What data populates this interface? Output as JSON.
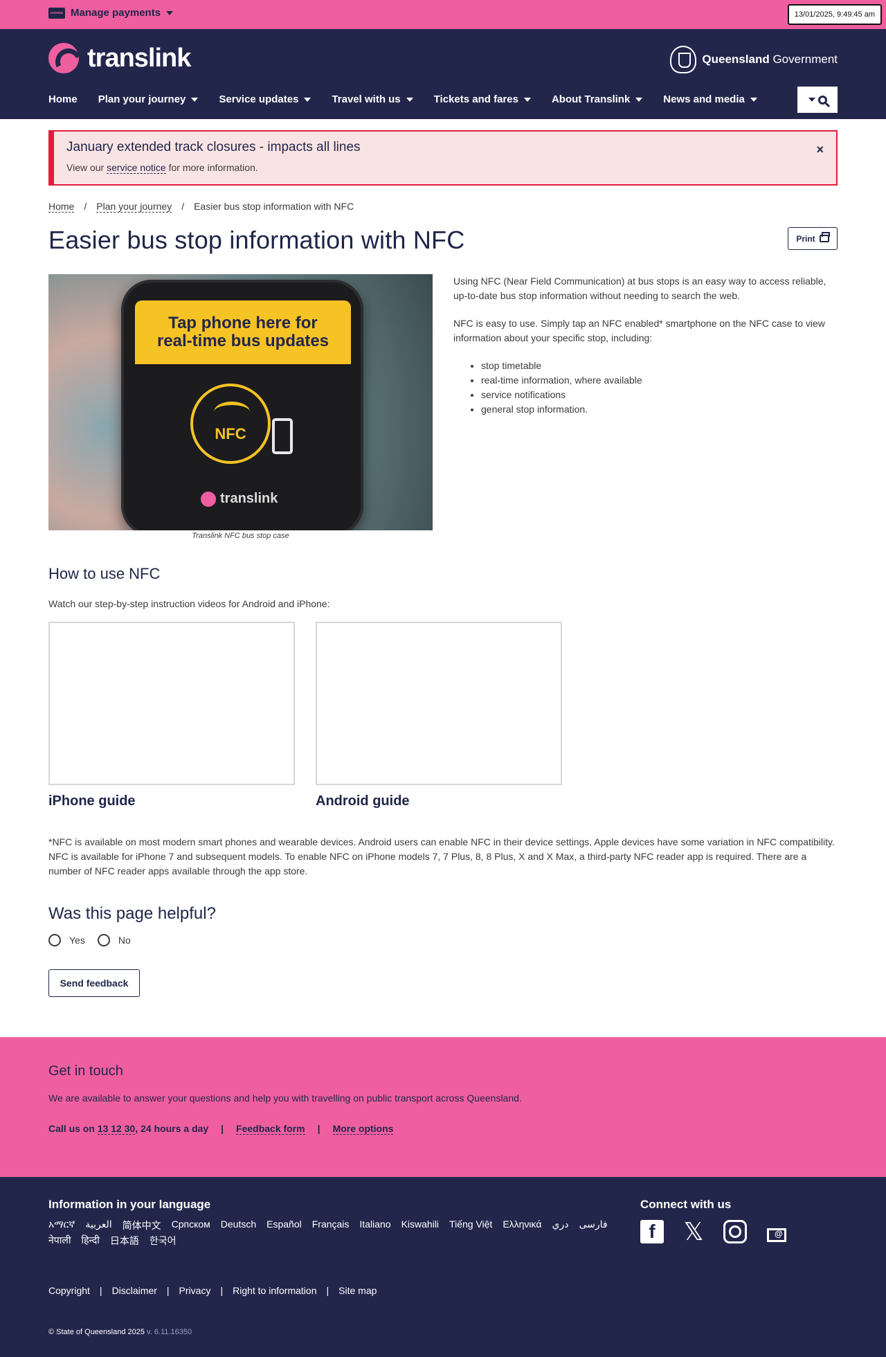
{
  "topbar": {
    "manage_payments": "Manage payments",
    "clock": "13/01/2025, 9:49:45 am"
  },
  "header": {
    "logo_text": "translink",
    "gov_bold": "Queensland",
    "gov_light": "Government",
    "nav": [
      {
        "label": "Home",
        "has_menu": false
      },
      {
        "label": "Plan your journey",
        "has_menu": true
      },
      {
        "label": "Service updates",
        "has_menu": true
      },
      {
        "label": "Travel with us",
        "has_menu": true
      },
      {
        "label": "Tickets and fares",
        "has_menu": true
      },
      {
        "label": "About Translink",
        "has_menu": true
      },
      {
        "label": "News and media",
        "has_menu": true
      }
    ]
  },
  "alert": {
    "title": "January extended track closures - impacts all lines",
    "body_prefix": "View our ",
    "link": "service notice",
    "body_suffix": " for more information.",
    "close": "×"
  },
  "breadcrumb": [
    "Home",
    "Plan your journey",
    "Easier bus stop information with NFC"
  ],
  "page": {
    "title": "Easier bus stop information with NFC",
    "print": "Print"
  },
  "hero": {
    "band_line1": "Tap phone here for",
    "band_line2": "real-time bus updates",
    "nfc": "NFC",
    "brand": "translink",
    "caption": "Translink NFC bus stop case"
  },
  "intro": {
    "p1": "Using NFC (Near Field Communication) at bus stops is an easy way to access reliable, up-to-date bus stop information without needing to search the web.",
    "p2": "NFC is easy to use. Simply tap an NFC enabled* smartphone on the NFC case to view information about your specific stop, including:",
    "items": [
      "stop timetable",
      "real-time information, where available",
      "service notifications",
      "general stop information."
    ]
  },
  "howto": {
    "heading": "How to use NFC",
    "lead": "Watch our step-by-step instruction videos for Android and iPhone:",
    "guides": [
      "iPhone guide",
      "Android guide"
    ]
  },
  "footnote": "*NFC is available on most modern smart phones and wearable devices. Android users can enable NFC in their device settings. Apple devices have some variation in NFC compatibility. NFC is available for iPhone 7 and subsequent models. To enable NFC on iPhone models 7, 7 Plus, 8, 8 Plus, X and X Max, a third-party NFC reader app is required. There are a number of NFC reader apps available through the app store.",
  "helpful": {
    "question": "Was this page helpful?",
    "yes": "Yes",
    "no": "No",
    "button": "Send feedback"
  },
  "touch": {
    "heading": "Get in touch",
    "text": "We are available to answer your questions and help you with travelling on public transport across Queensland.",
    "call_prefix": "Call us on ",
    "phone": "13 12 30",
    "call_suffix": ", 24 hours a day",
    "sep": "|",
    "feedback": "Feedback form",
    "more": "More options"
  },
  "footer": {
    "lang_heading": "Information in your language",
    "languages": [
      "አማርኛ",
      "العربية",
      "简体中文",
      "Српском",
      "Deutsch",
      "Español",
      "Français",
      "Italiano",
      "Kiswahili",
      "Tiếng Việt",
      "Ελληνικά",
      "دري",
      "فارسی",
      "नेपाली",
      "हिन्दी",
      "日本語",
      "한국어"
    ],
    "connect_heading": "Connect with us",
    "legal": [
      "Copyright",
      "Disclaimer",
      "Privacy",
      "Right to information",
      "Site map"
    ],
    "copyright": "© State of Queensland 2025",
    "version": " v. 6.11.16350"
  }
}
